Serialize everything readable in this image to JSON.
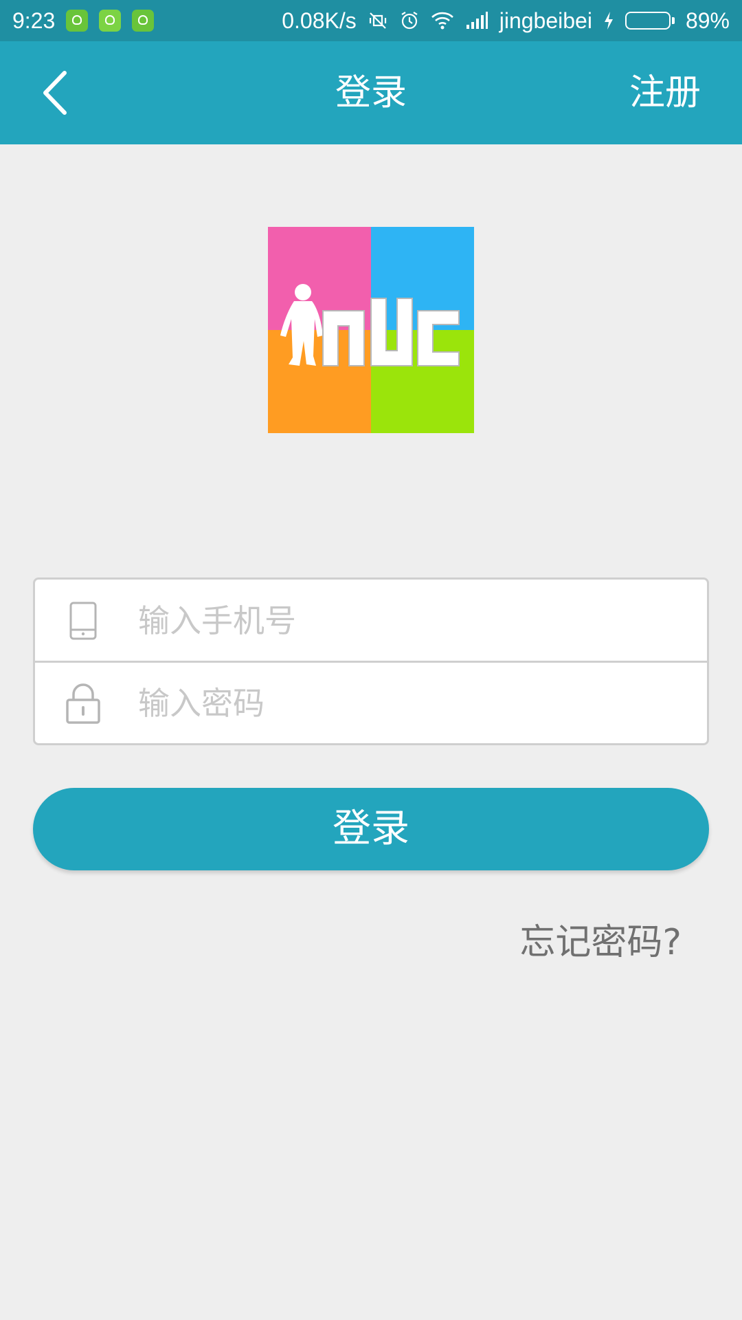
{
  "status_bar": {
    "time": "9:23",
    "net_speed": "0.08K/s",
    "carrier": "jingbeibei",
    "battery": "89%",
    "battery_level": 0.89,
    "colors": {
      "background": "#1f8fa2",
      "battery_fill": "#3bd12c"
    }
  },
  "app_bar": {
    "title": "登录",
    "right_action": "注册",
    "back_icon": "chevron-left-icon",
    "color": "#23a5bd"
  },
  "logo": {
    "text": "NUC",
    "colors": {
      "pink": "#f25fad",
      "blue": "#2eb4f4",
      "orange": "#ff9c22",
      "green": "#9be40b"
    }
  },
  "form": {
    "phone": {
      "placeholder": "输入手机号",
      "value": "",
      "icon": "phone-icon"
    },
    "password": {
      "placeholder": "输入密码",
      "value": "",
      "icon": "lock-icon"
    }
  },
  "login_button": {
    "label": "登录",
    "color": "#23a5bd"
  },
  "forgot_password": "忘记密码?"
}
